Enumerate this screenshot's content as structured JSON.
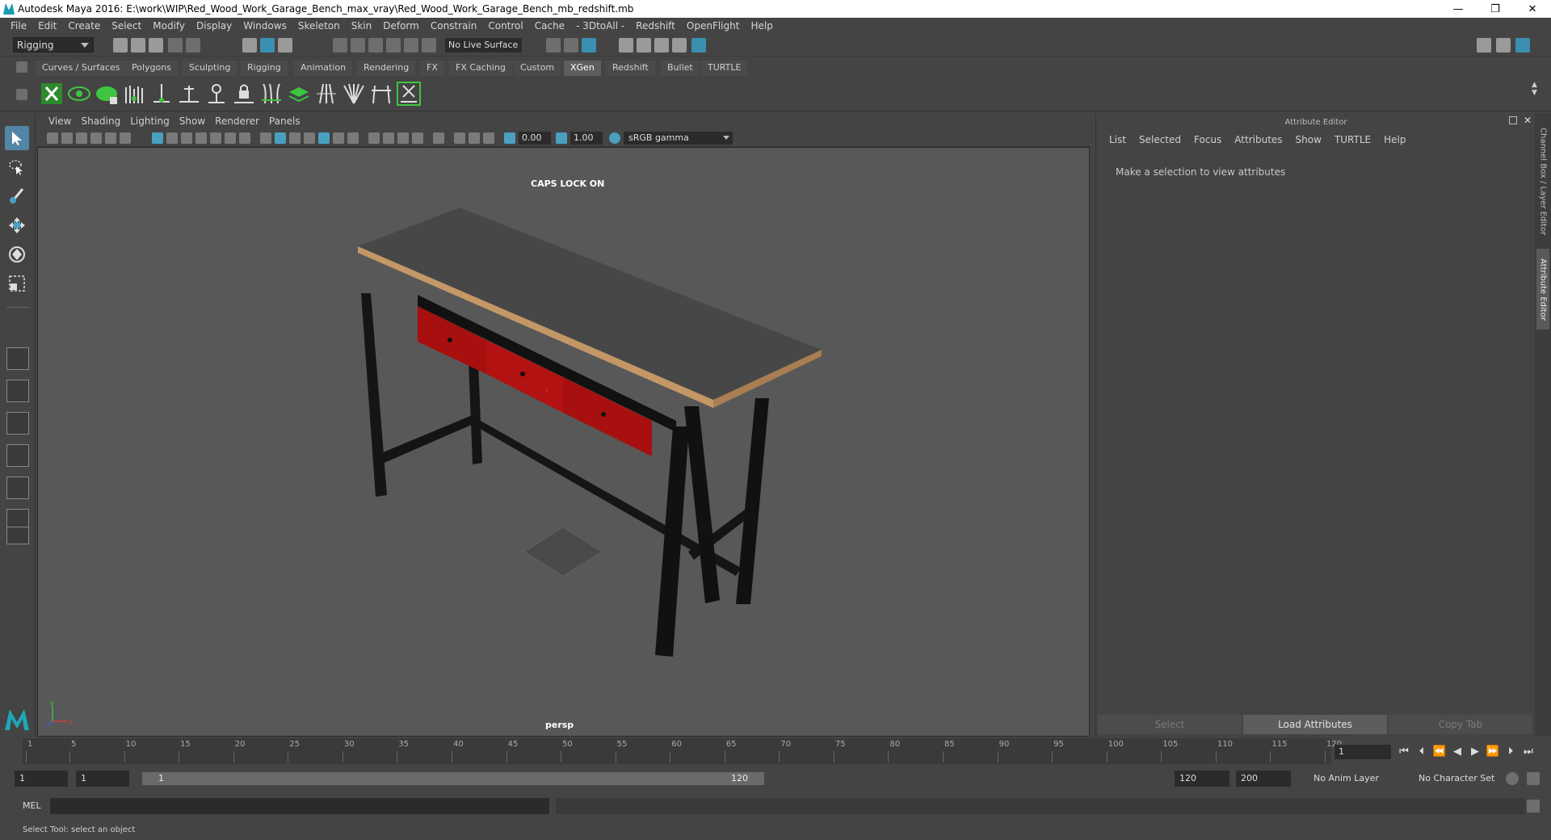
{
  "window": {
    "title": "Autodesk Maya 2016: E:\\work\\WIP\\Red_Wood_Work_Garage_Bench_max_vray\\Red_Wood_Work_Garage_Bench_mb_redshift.mb",
    "minimize": "—",
    "restore": "❐",
    "close": "✕"
  },
  "menubar": [
    "File",
    "Edit",
    "Create",
    "Select",
    "Modify",
    "Display",
    "Windows",
    "Skeleton",
    "Skin",
    "Deform",
    "Constrain",
    "Control",
    "Cache",
    "- 3DtoAll -",
    "Redshift",
    "OpenFlight",
    "Help"
  ],
  "statusline": {
    "mode": "Rigging",
    "live_surface": "No Live Surface"
  },
  "shelf": {
    "tabs": [
      "Curves / Surfaces",
      "Polygons",
      "Sculpting",
      "Rigging",
      "Animation",
      "Rendering",
      "FX",
      "FX Caching",
      "Custom",
      "XGen",
      "Redshift",
      "Bullet",
      "TURTLE"
    ],
    "active_tab": "XGen"
  },
  "viewport": {
    "menu": [
      "View",
      "Shading",
      "Lighting",
      "Show",
      "Renderer",
      "Panels"
    ],
    "exposure": "0.00",
    "gamma": "1.00",
    "color_space": "sRGB gamma",
    "caps_lock": "CAPS LOCK ON",
    "camera": "persp",
    "axis_y": "y",
    "axis_x": "x",
    "bench_colors": {
      "top": "#4a4a4a",
      "edge": "#c09060",
      "drawers": "#b01010",
      "frame": "#141414"
    }
  },
  "attribute_editor": {
    "title": "Attribute Editor",
    "menu": [
      "List",
      "Selected",
      "Focus",
      "Attributes",
      "Show",
      "TURTLE",
      "Help"
    ],
    "hint": "Make a selection to view attributes",
    "buttons": {
      "select": "Select",
      "load": "Load Attributes",
      "copy": "Copy Tab"
    }
  },
  "side_tabs": {
    "channel_box": "Channel Box / Layer Editor",
    "attribute_editor": "Attribute Editor"
  },
  "timeline": {
    "ticks": [
      "1",
      "5",
      "10",
      "15",
      "20",
      "25",
      "30",
      "35",
      "40",
      "45",
      "50",
      "55",
      "60",
      "65",
      "70",
      "75",
      "80",
      "85",
      "90",
      "95",
      "100",
      "105",
      "110",
      "115",
      "120"
    ],
    "current_frame": "1"
  },
  "range": {
    "start": "1",
    "playback_start": "1",
    "slider_start": "1",
    "slider_end": "120",
    "playback_end": "120",
    "end": "200",
    "anim_layer": "No Anim Layer",
    "character_set": "No Character Set"
  },
  "cmdline": {
    "label": "MEL"
  },
  "helpline": {
    "text": "Select Tool: select an object"
  }
}
